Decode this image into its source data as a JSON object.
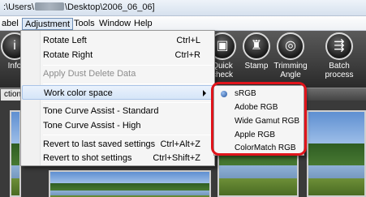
{
  "titlebar": {
    "prefix": ":\\Users\\",
    "suffix": "\\Desktop\\2006_06_06]"
  },
  "menubar": {
    "items": [
      "abel",
      "Adjustment",
      "Tools",
      "Window",
      "Help"
    ]
  },
  "toolbar": {
    "tools": [
      {
        "label": "Info",
        "icon": "info-icon"
      },
      {
        "label": "Quick check",
        "icon": "quick-check-icon"
      },
      {
        "label": "Stamp",
        "icon": "stamp-icon"
      },
      {
        "label": "Trimming Angle",
        "icon": "trimming-icon"
      },
      {
        "label": "Batch process",
        "icon": "batch-process-icon"
      }
    ],
    "tab_label": "ction(0)"
  },
  "adjustment_menu": {
    "items": [
      {
        "label": "Rotate Left",
        "shortcut": "Ctrl+L"
      },
      {
        "label": "Rotate Right",
        "shortcut": "Ctrl+R"
      },
      {
        "label": "Apply Dust Delete Data",
        "shortcut": ""
      },
      {
        "label": "Work color space",
        "shortcut": ""
      },
      {
        "label": "Tone Curve Assist - Standard",
        "shortcut": ""
      },
      {
        "label": "Tone Curve Assist - High",
        "shortcut": ""
      },
      {
        "label": "Revert to last saved settings",
        "shortcut": "Ctrl+Alt+Z"
      },
      {
        "label": "Revert to shot settings",
        "shortcut": "Ctrl+Shift+Z"
      }
    ]
  },
  "color_space_menu": {
    "items": [
      "sRGB",
      "Adobe RGB",
      "Wide Gamut RGB",
      "Apple RGB",
      "ColorMatch RGB"
    ],
    "selected": "sRGB"
  },
  "colors": {
    "annotation_outline": "#e0141b",
    "menu_highlight": "#d5e5f8"
  }
}
